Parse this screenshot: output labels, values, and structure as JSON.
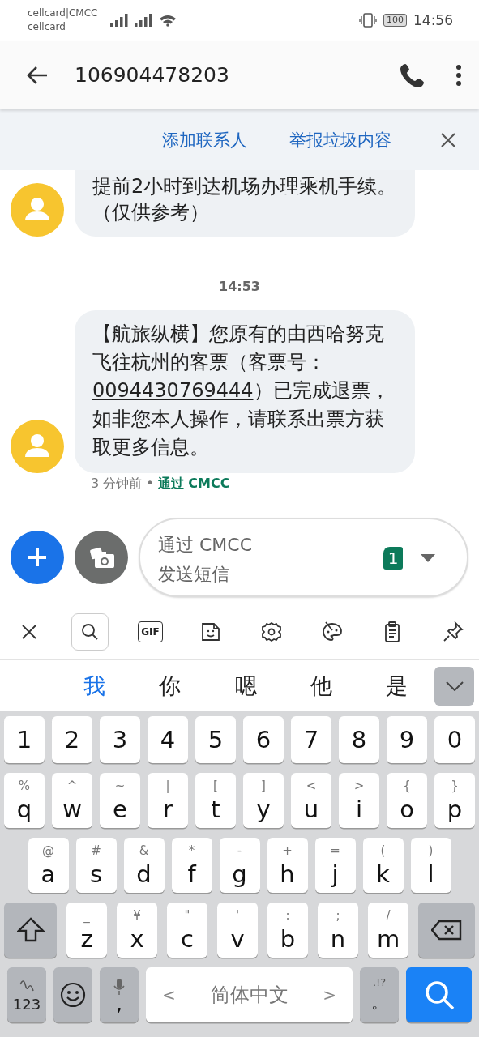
{
  "status_bar": {
    "carrier_1": "cellcard|CMCC",
    "carrier_2": "cellcard",
    "battery": "100",
    "time": "14:56"
  },
  "header": {
    "title": "106904478203"
  },
  "banner": {
    "actions": [
      "添加联系人",
      "举报垃圾内容"
    ]
  },
  "thread": [
    {
      "kind": "message",
      "parts": [
        {
          "kind": "text",
          "text": "提前2小时到达机场办理乘机手续。（仅供参考）"
        }
      ]
    },
    {
      "kind": "time",
      "text": "14:53"
    },
    {
      "kind": "message",
      "parts": [
        {
          "kind": "text",
          "text": "【航旅纵横】您原有的由西哈努克飞往杭州的客票（客票号："
        },
        {
          "kind": "link",
          "text": "0094430769444"
        },
        {
          "kind": "text",
          "text": "）已完成退票，如非您本人操作，请联系出票方获取更多信息。"
        }
      ]
    },
    {
      "kind": "meta",
      "age": "3 分钟前",
      "separator": "•",
      "via": "通过 CMCC"
    }
  ],
  "compose": {
    "placeholder": "通过 CMCC\n发送短信",
    "sim": "1"
  },
  "toolbar": [
    {
      "kind": "close",
      "selected": false
    },
    {
      "kind": "search",
      "selected": true
    },
    {
      "kind": "gif",
      "label": "GIF",
      "selected": false
    },
    {
      "kind": "sticker",
      "selected": false
    },
    {
      "kind": "settings",
      "selected": false
    },
    {
      "kind": "palette",
      "selected": false
    },
    {
      "kind": "clipboard",
      "selected": false
    },
    {
      "kind": "pin",
      "selected": false
    }
  ],
  "candidates": [
    {
      "text": "我",
      "selected": true
    },
    {
      "text": "你",
      "selected": false
    },
    {
      "text": "嗯",
      "selected": false
    },
    {
      "text": "他",
      "selected": false
    },
    {
      "text": "是",
      "selected": false
    }
  ],
  "keyboard": {
    "rows": [
      [
        {
          "label": "1"
        },
        {
          "label": "2"
        },
        {
          "label": "3"
        },
        {
          "label": "4"
        },
        {
          "label": "5"
        },
        {
          "label": "6"
        },
        {
          "label": "7"
        },
        {
          "label": "8"
        },
        {
          "label": "9"
        },
        {
          "label": "0"
        }
      ],
      [
        {
          "label": "q",
          "hint": "%"
        },
        {
          "label": "w",
          "hint": "^"
        },
        {
          "label": "e",
          "hint": "~"
        },
        {
          "label": "r",
          "hint": "|"
        },
        {
          "label": "t",
          "hint": "["
        },
        {
          "label": "y",
          "hint": "]"
        },
        {
          "label": "u",
          "hint": "<"
        },
        {
          "label": "i",
          "hint": ">"
        },
        {
          "label": "o",
          "hint": "{"
        },
        {
          "label": "p",
          "hint": "}"
        }
      ],
      [
        {
          "label": "a",
          "hint": "@"
        },
        {
          "label": "s",
          "hint": "#"
        },
        {
          "label": "d",
          "hint": "&"
        },
        {
          "label": "f",
          "hint": "*"
        },
        {
          "label": "g",
          "hint": "-"
        },
        {
          "label": "h",
          "hint": "+"
        },
        {
          "label": "j",
          "hint": "="
        },
        {
          "label": "k",
          "hint": "("
        },
        {
          "label": "l",
          "hint": ")"
        }
      ],
      [
        {
          "kind": "shift"
        },
        {
          "label": "z",
          "hint": "_"
        },
        {
          "label": "x",
          "hint": "¥"
        },
        {
          "label": "c",
          "hint": "\""
        },
        {
          "label": "v",
          "hint": "'"
        },
        {
          "label": "b",
          "hint": ":"
        },
        {
          "label": "n",
          "hint": ";"
        },
        {
          "label": "m",
          "hint": "/"
        },
        {
          "kind": "backspace"
        }
      ],
      [
        {
          "kind": "numbers",
          "label": "123"
        },
        {
          "kind": "emoji"
        },
        {
          "kind": "comma",
          "label": ","
        },
        {
          "kind": "space",
          "label": "简体中文",
          "left": "<",
          "right": ">"
        },
        {
          "kind": "period",
          "label": "。",
          "hint": ".!?"
        },
        {
          "kind": "search"
        }
      ]
    ]
  }
}
